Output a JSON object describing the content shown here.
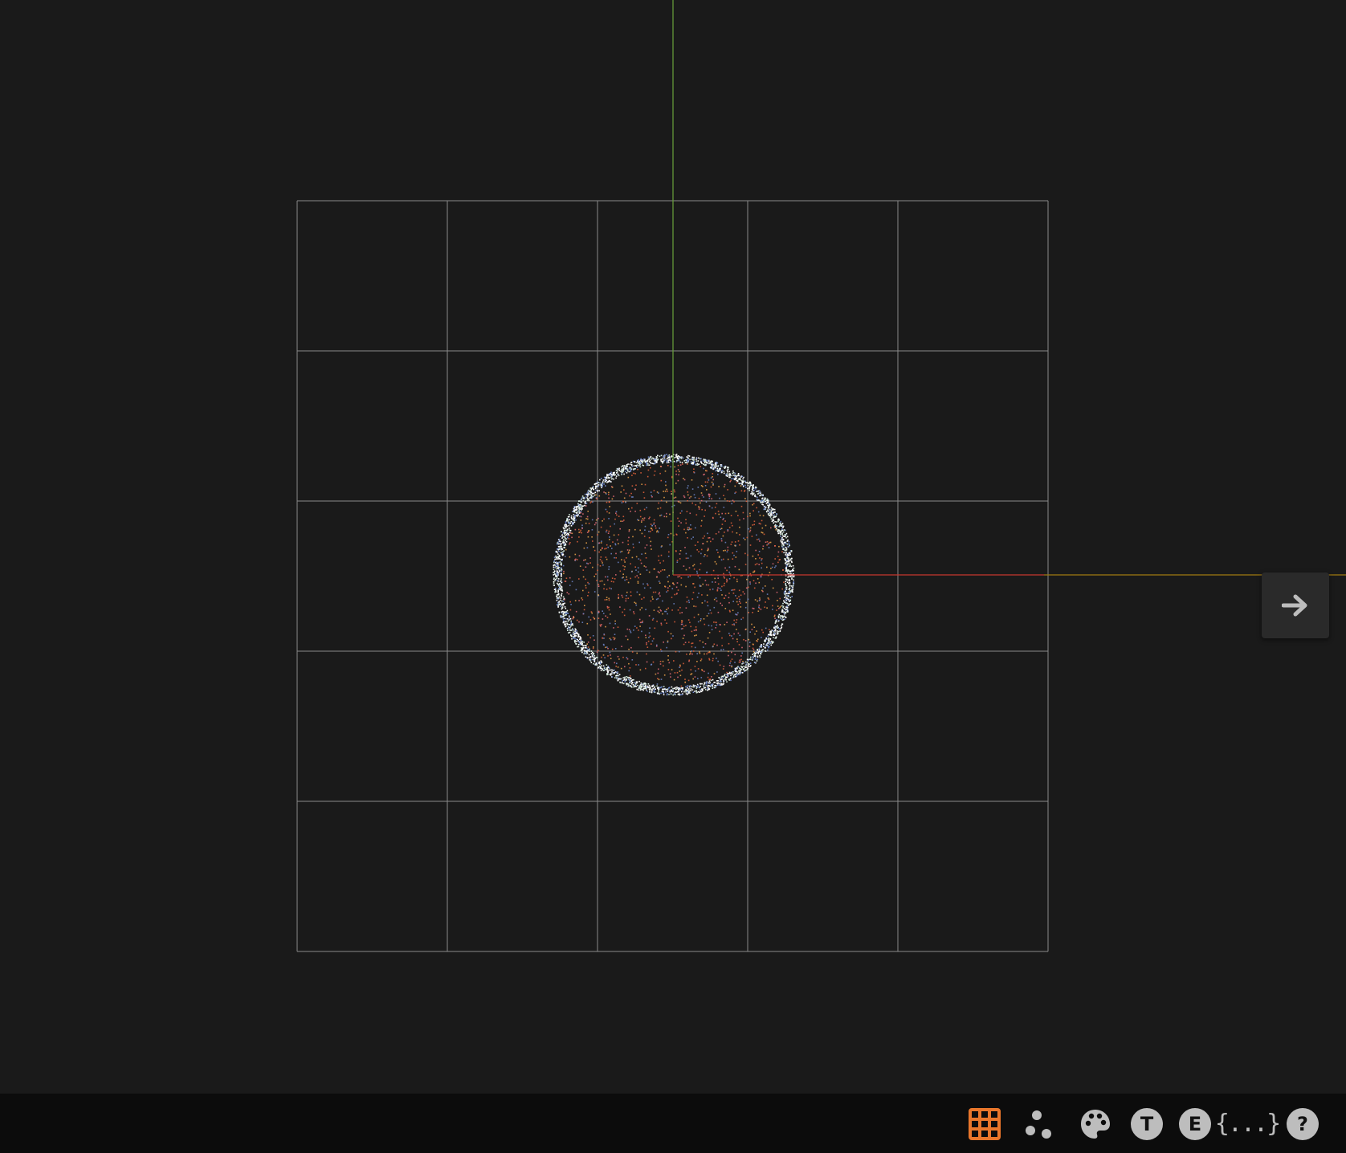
{
  "viewport": {
    "background": "#1a1a1a",
    "grid": {
      "divisions": 5,
      "line_color": "#8a8a8a"
    },
    "axes": {
      "x_color": "#c8372d",
      "x_far_color": "#a07a10",
      "y_color": "#6aa33c"
    },
    "point_cloud": {
      "shape": "sphere",
      "colors": [
        "#ffffff",
        "#cfe6d8",
        "#6d86c9",
        "#e6633b",
        "#f0a64a",
        "#e86d7a"
      ]
    }
  },
  "navigation": {
    "next_icon": "arrow-right-icon",
    "icon_color": "#bdbdbd"
  },
  "toolbar": {
    "background": "#0c0c0c",
    "accent": "#e9762b",
    "icon_color": "#bdbdbd",
    "items": [
      {
        "name": "grid-toggle-icon",
        "active": true
      },
      {
        "name": "points-icon",
        "active": false
      },
      {
        "name": "palette-icon",
        "active": false
      },
      {
        "name": "text-icon",
        "glyph": "T",
        "active": false
      },
      {
        "name": "export-icon",
        "glyph": "E",
        "active": false
      },
      {
        "name": "json-icon",
        "glyph": "{...}",
        "active": false
      },
      {
        "name": "help-icon",
        "glyph": "?",
        "active": false
      }
    ]
  }
}
